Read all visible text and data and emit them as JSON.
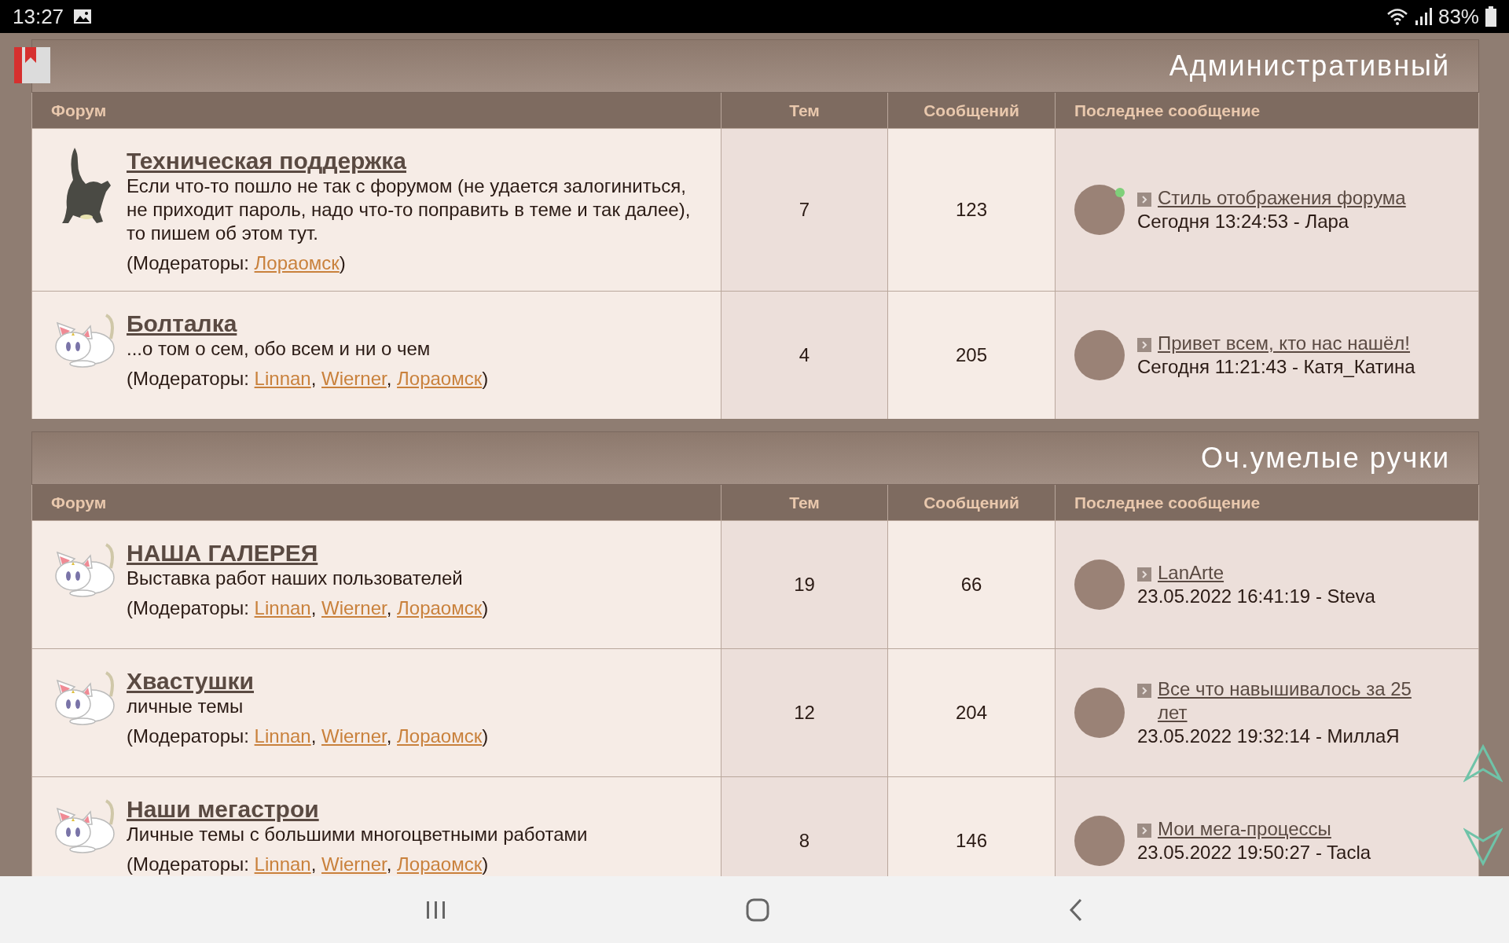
{
  "status_bar": {
    "time": "13:27",
    "battery": "83%"
  },
  "categories": [
    {
      "title": "Административный",
      "columns": [
        "Форум",
        "Тем",
        "Сообщений",
        "Последнее сообщение"
      ],
      "forums": [
        {
          "kind": "dark-cat",
          "title": "Техническая поддержка",
          "description": "Если что-то пошло не так с форумом (не удается залогиниться, не приходит пароль, надо что-то поправить в теме и так далее), то пишем об этом тут.",
          "moderators_prefix": "(Модераторы: ",
          "moderators": [
            {
              "name": "Лораомск",
              "after": ")"
            }
          ],
          "topics": "7",
          "posts": "123",
          "last_post": {
            "title": "Стиль отображения форума",
            "meta": "Сегодня 13:24:53 - Лара",
            "online": true
          }
        },
        {
          "kind": "white-cat",
          "title": "Болталка",
          "description": "...о том о сем, обо всем и ни о чем",
          "moderators_prefix": "(Модераторы: ",
          "moderators": [
            {
              "name": "Linnan",
              "after": ", "
            },
            {
              "name": "Wierner",
              "after": ", "
            },
            {
              "name": "Лораомск",
              "after": ")"
            }
          ],
          "topics": "4",
          "posts": "205",
          "last_post": {
            "title": "Привет всем, кто нас нашёл!",
            "meta": "Сегодня 11:21:43 - Катя_Катина",
            "online": false
          }
        }
      ]
    },
    {
      "title": "Оч.умелые ручки",
      "columns": [
        "Форум",
        "Тем",
        "Сообщений",
        "Последнее сообщение"
      ],
      "forums": [
        {
          "kind": "white-cat",
          "title": "НАША ГАЛЕРЕЯ",
          "description": "Выставка работ наших пользователей",
          "moderators_prefix": "(Модераторы: ",
          "moderators": [
            {
              "name": "Linnan",
              "after": ", "
            },
            {
              "name": "Wierner",
              "after": ", "
            },
            {
              "name": "Лораомск",
              "after": ")"
            }
          ],
          "topics": "19",
          "posts": "66",
          "last_post": {
            "title": "LanArte",
            "meta": "23.05.2022 16:41:19 - Steva",
            "online": false
          }
        },
        {
          "kind": "white-cat",
          "title": "Хвастушки",
          "description": "личные темы",
          "moderators_prefix": "(Модераторы: ",
          "moderators": [
            {
              "name": "Linnan",
              "after": ", "
            },
            {
              "name": "Wierner",
              "after": ", "
            },
            {
              "name": "Лораомск",
              "after": ")"
            }
          ],
          "topics": "12",
          "posts": "204",
          "last_post": {
            "title": "Все что навышивалось за 25 лет",
            "meta": "23.05.2022 19:32:14 - МиллаЯ",
            "online": false
          }
        },
        {
          "kind": "white-cat",
          "title": "Наши мегастрои",
          "description": "Личные темы с большими многоцветными работами",
          "moderators_prefix": "(Модераторы: ",
          "moderators": [
            {
              "name": "Linnan",
              "after": ", "
            },
            {
              "name": "Wierner",
              "after": ", "
            },
            {
              "name": "Лораомск",
              "after": ")"
            }
          ],
          "topics": "8",
          "posts": "146",
          "last_post": {
            "title": "Мои мега-процессы",
            "meta": "23.05.2022 19:50:27 - Tacla",
            "online": false
          }
        }
      ]
    }
  ]
}
